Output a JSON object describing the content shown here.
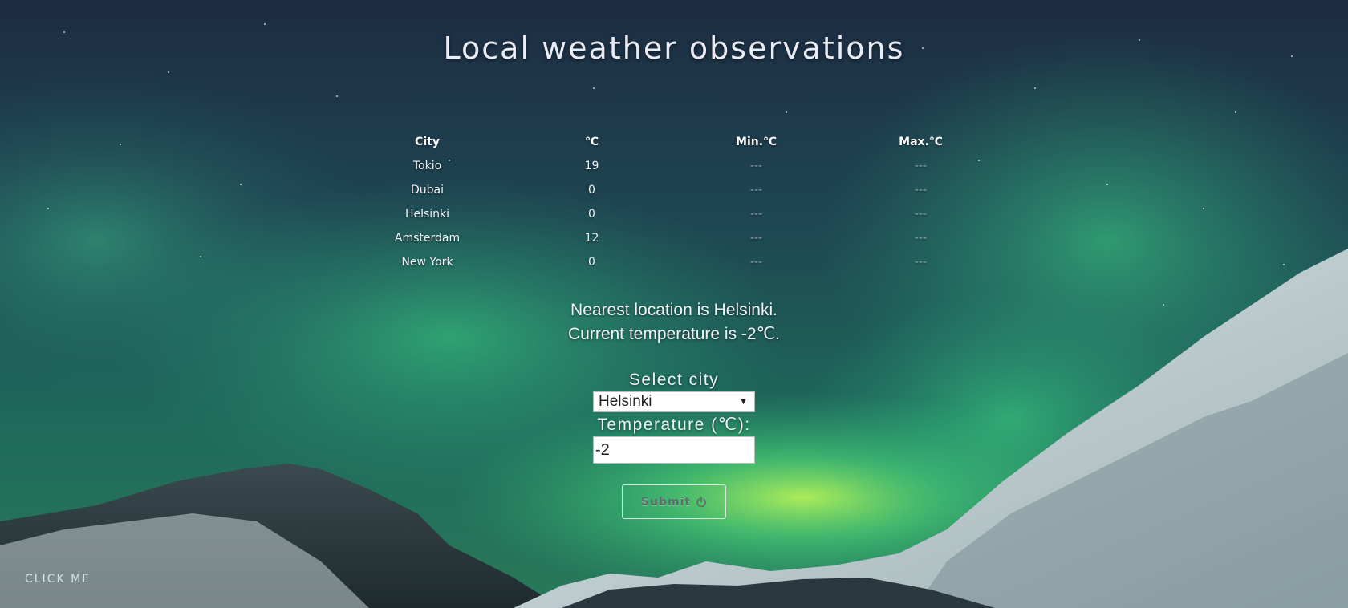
{
  "page": {
    "title": "Local weather observations"
  },
  "table": {
    "headers": [
      "City",
      "℃",
      "Min.℃",
      "Max.℃"
    ],
    "rows": [
      {
        "city": "Tokio",
        "temp": "19",
        "min": "---",
        "max": "---"
      },
      {
        "city": "Dubai",
        "temp": "0",
        "min": "---",
        "max": "---"
      },
      {
        "city": "Helsinki",
        "temp": "0",
        "min": "---",
        "max": "---"
      },
      {
        "city": "Amsterdam",
        "temp": "12",
        "min": "---",
        "max": "---"
      },
      {
        "city": "New York",
        "temp": "0",
        "min": "---",
        "max": "---"
      }
    ]
  },
  "location": {
    "line1": "Nearest location is Helsinki.",
    "line2": "Current temperature is -2℃."
  },
  "form": {
    "select_label": "Select city",
    "selected_city": "Helsinki",
    "temperature_label": "Temperature (℃):",
    "temperature_value": "-2",
    "submit_label": "Submit"
  },
  "footer": {
    "click_me_label": "CLICK ME"
  },
  "icons": {
    "submit_icon": "power-icon",
    "select_icon": "dropdown-arrow-icon"
  },
  "colors": {
    "sky_top": "#1c3046",
    "aurora": "#3fdc7a",
    "mountain": "#2a3a40",
    "snow": "#dfe9ea"
  }
}
